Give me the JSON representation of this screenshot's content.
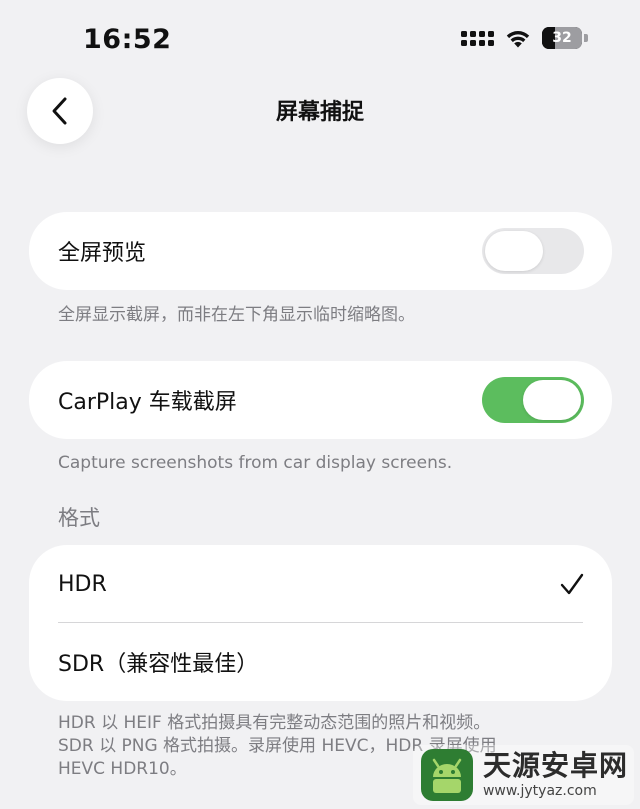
{
  "status_bar": {
    "time": "16:52",
    "battery_level": "32",
    "battery_fraction": 0.32,
    "icons": [
      "cellular-signal-icon",
      "wifi-icon",
      "battery-icon"
    ]
  },
  "nav": {
    "title": "屏幕捕捉",
    "back_icon": "chevron-left-icon"
  },
  "settings": {
    "fullscreen_preview": {
      "label": "全屏预览",
      "enabled": false,
      "footnote": "全屏显示截屏，而非在左下角显示临时缩略图。"
    },
    "carplay": {
      "label": "CarPlay 车载截屏",
      "enabled": true,
      "footnote": "Capture screenshots from car display screens."
    },
    "format": {
      "header": "格式",
      "options": [
        {
          "label": "HDR",
          "selected": true
        },
        {
          "label": "SDR（兼容性最佳）",
          "selected": false
        }
      ],
      "footnote_lines": [
        "HDR 以 HEIF 格式拍摄具有完整动态范围的照片和视频。",
        "SDR 以 PNG 格式拍摄。录屏使用 HEVC，HDR 录屏使用",
        "HEVC HDR10。"
      ]
    }
  },
  "watermark": {
    "name": "天源安卓网",
    "url": "www.jytyaz.com"
  },
  "colors": {
    "background": "#f1f1f3",
    "card": "#ffffff",
    "toggle_on": "#5cbd5e",
    "toggle_off": "#e8e8ea",
    "secondary_text": "#7d7d82"
  }
}
